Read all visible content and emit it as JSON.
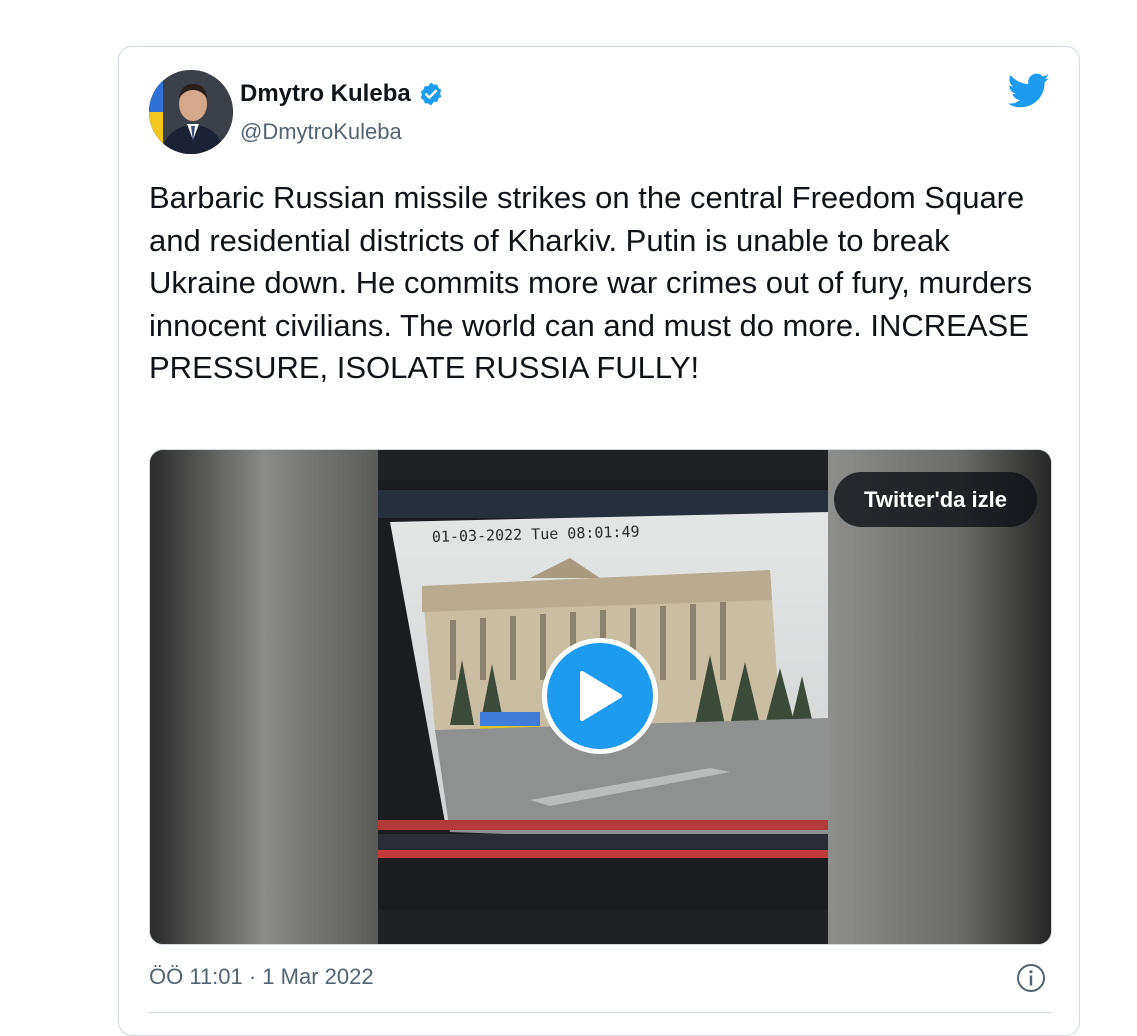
{
  "tweet": {
    "author_name": "Dmytro Kuleba",
    "author_handle": "@DmytroKuleba",
    "verified": true,
    "text": "Barbaric Russian missile strikes on the central Freedom Square and residential districts of Kharkiv. Putin is unable to break Ukraine down. He commits more war crimes out of fury, murders innocent civilians. The world can and must do more. INCREASE PRESSURE, ISOLATE RUSSIA FULLY!",
    "timestamp": "ÖÖ 11:01 · 1 Mar 2022"
  },
  "media": {
    "watch_label": "Twitter'da izle",
    "cctv_overlay": "01-03-2022 Tue 08:01:49"
  },
  "icons": {
    "brand": "twitter-bird-icon",
    "verified": "verified-badge-icon",
    "play": "play-icon",
    "info": "info-icon"
  },
  "colors": {
    "accent": "#1d9bf0",
    "text": "#0f1419",
    "secondary": "#536471",
    "border": "#cfd9de"
  }
}
